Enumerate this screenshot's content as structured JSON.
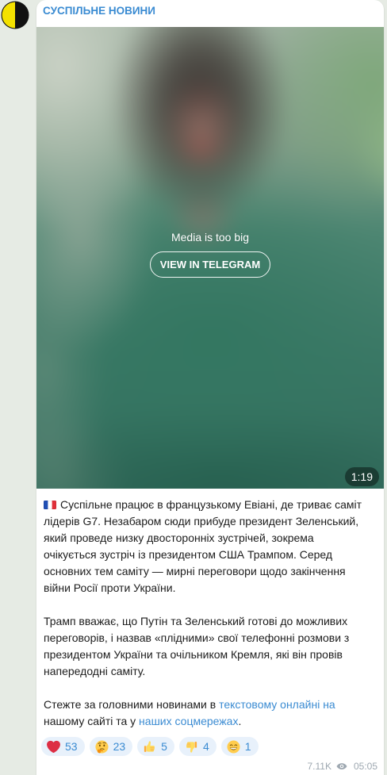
{
  "channel": {
    "name": "СУСПІЛЬНЕ НОВИНИ",
    "avatar_icon": "suspilne-logo-icon"
  },
  "media": {
    "notice": "Media is too big",
    "button_label": "VIEW IN TELEGRAM",
    "duration": "1:19"
  },
  "message": {
    "lead_icon": "flag-france-icon",
    "paragraphs": [
      {
        "lines": [
          "Суспільне працює в французькому Евіані, де триває саміт",
          "лідерів G7. Незабаром сюди прибуде президент Зеленський,",
          "який проведе низку двосторонніх зустрічей, зокрема",
          "очікується зустріч із президентом США Трампом. Серед",
          "основних тем саміту — мирні переговори щодо закінчення",
          "війни Росії проти України."
        ]
      },
      {
        "lines": [
          "Трамп вважає, що Путін та Зеленський готові до можливих",
          "переговорів, і назвав «плідними» свої телефонні розмови з",
          "президентом України та очільником Кремля, які він провів",
          "напередодні саміту."
        ]
      },
      {
        "lines": [
          {
            "text": "Стежте за головними новинами в",
            "link": "текстовому онлайні на"
          },
          {
            "text": "нашому сайті та у",
            "link": "наших соцмережах",
            "after": "."
          }
        ]
      }
    ]
  },
  "reactions": [
    {
      "icon": "red-heart-icon",
      "count": 53
    },
    {
      "icon": "thinking-face-icon",
      "count": 23
    },
    {
      "icon": "thumbs-up-icon",
      "count": 5
    },
    {
      "icon": "thumbs-down-icon",
      "count": 4
    },
    {
      "icon": "beaming-face-icon",
      "count": 1
    }
  ],
  "footer": {
    "views": "7.11K",
    "views_icon": "eye-icon",
    "time": "05:05"
  },
  "colors": {
    "link": "#3a8bd2",
    "channel_name": "#3a8bd2",
    "reaction_bg": "#e8f1fb",
    "meta_text": "#9ea8b1",
    "background": "#e6ebe4",
    "text": "#1c1c1c"
  }
}
